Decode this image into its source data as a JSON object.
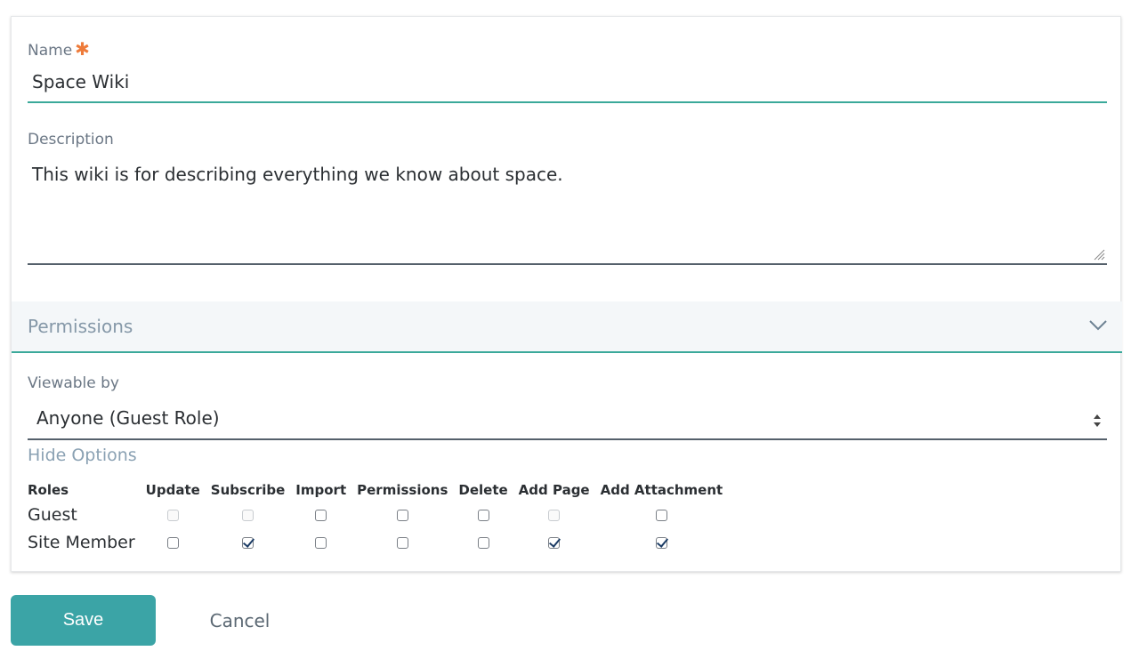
{
  "form": {
    "name_label": "Name",
    "required_mark": "✱",
    "name_value": "Space Wiki",
    "description_label": "Description",
    "description_value": "This wiki is for describing everything we know about space."
  },
  "permissions": {
    "title": "Permissions",
    "viewable_by_label": "Viewable by",
    "viewable_by_value": "Anyone (Guest Role)",
    "hide_options_label": "Hide Options",
    "columns": [
      "Roles",
      "Update",
      "Subscribe",
      "Import",
      "Permissions",
      "Delete",
      "Add Page",
      "Add Attachment"
    ],
    "rows": [
      {
        "role": "Guest",
        "cells": [
          {
            "checked": false,
            "disabled": true
          },
          {
            "checked": false,
            "disabled": true
          },
          {
            "checked": false,
            "disabled": false
          },
          {
            "checked": false,
            "disabled": false
          },
          {
            "checked": false,
            "disabled": false
          },
          {
            "checked": false,
            "disabled": true
          },
          {
            "checked": false,
            "disabled": false
          }
        ]
      },
      {
        "role": "Site Member",
        "cells": [
          {
            "checked": false,
            "disabled": false
          },
          {
            "checked": true,
            "disabled": false
          },
          {
            "checked": false,
            "disabled": false
          },
          {
            "checked": false,
            "disabled": false
          },
          {
            "checked": false,
            "disabled": false
          },
          {
            "checked": true,
            "disabled": false
          },
          {
            "checked": true,
            "disabled": false
          }
        ]
      }
    ]
  },
  "actions": {
    "save_label": "Save",
    "cancel_label": "Cancel"
  },
  "colors": {
    "accent": "#3aa99a",
    "button": "#3ba4a6",
    "required": "#ee7b3a"
  },
  "icons": {
    "chevron": "chevron-down-icon",
    "select": "select-updown-icon",
    "resize": "resize-grip-icon",
    "required": "asterisk-icon"
  }
}
